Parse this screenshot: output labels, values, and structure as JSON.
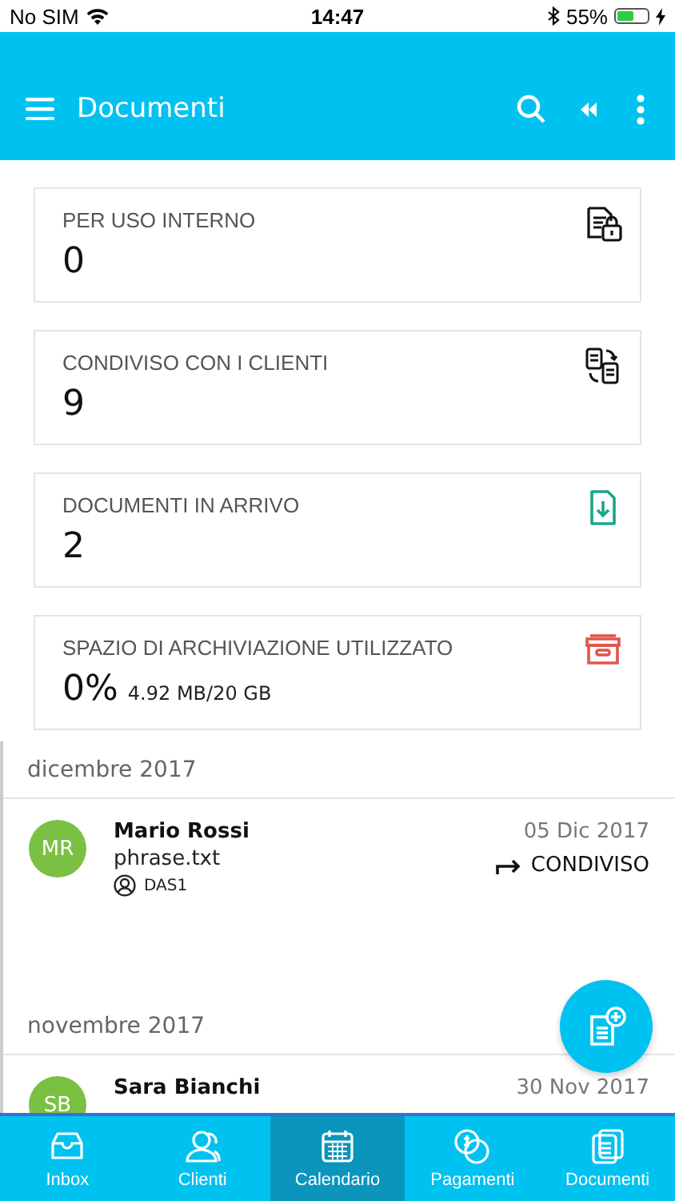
{
  "status_bar": {
    "carrier": "No SIM",
    "time": "14:47",
    "battery": "55%"
  },
  "app_bar": {
    "title": "Documenti"
  },
  "cards": [
    {
      "kind": "internal",
      "label": "PER USO INTERNO",
      "value": "0"
    },
    {
      "kind": "shared",
      "label": "CONDIVISO CON I CLIENTI",
      "value": "9"
    },
    {
      "kind": "incoming",
      "label": "DOCUMENTI IN ARRIVO",
      "value": "2"
    },
    {
      "kind": "storage",
      "label": "SPAZIO DI ARCHIVIAZIONE UTILIZZATO",
      "value": "0%",
      "detail": "4.92 MB/20 GB"
    }
  ],
  "sections": [
    {
      "title": "dicembre 2017",
      "items": [
        {
          "initials": "MR",
          "color": "#7ac143",
          "name": "Mario Rossi",
          "file": "phrase.txt",
          "owner": "DAS1",
          "date": "05 Dic 2017",
          "status": "CONDIVISO"
        }
      ]
    },
    {
      "title": "novembre 2017",
      "items": [
        {
          "initials": "SB",
          "color": "#7ac143",
          "name": "Sara Bianchi",
          "date": "30 Nov 2017"
        }
      ]
    }
  ],
  "tabs": [
    {
      "kind": "inbox",
      "label": "Inbox",
      "selected": false
    },
    {
      "kind": "clients",
      "label": "Clienti",
      "selected": false
    },
    {
      "kind": "calendar",
      "label": "Calendario",
      "selected": true
    },
    {
      "kind": "payments",
      "label": "Pagamenti",
      "selected": false
    },
    {
      "kind": "documents",
      "label": "Documenti",
      "selected": false
    }
  ]
}
